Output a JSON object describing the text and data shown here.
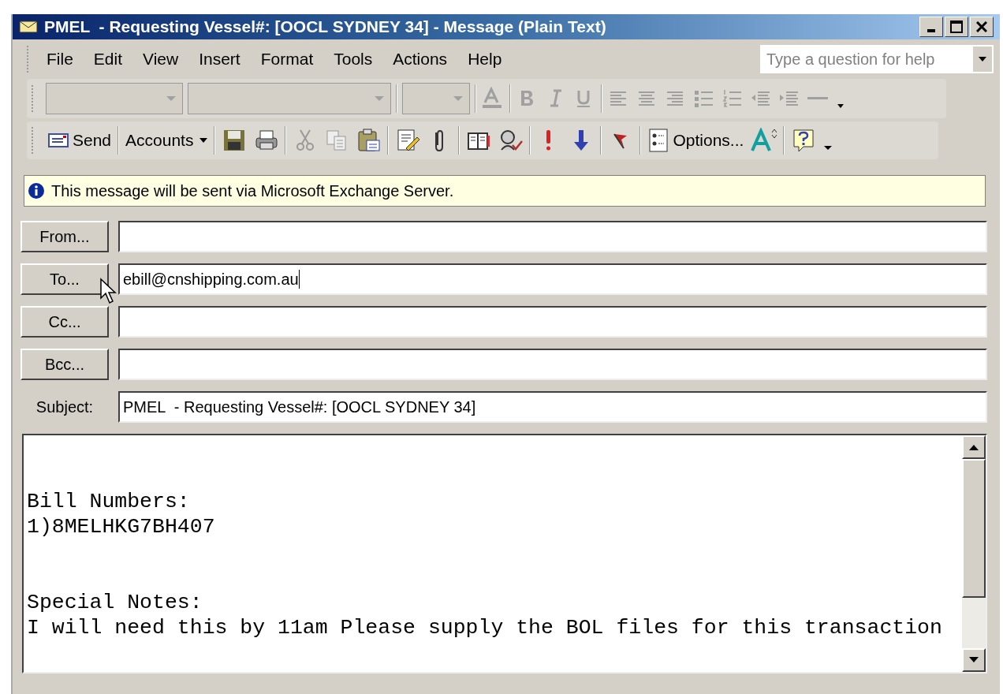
{
  "window": {
    "title": "PMEL  - Requesting Vessel#: [OOCL SYDNEY 34] - Message (Plain Text)"
  },
  "menu": [
    "File",
    "Edit",
    "View",
    "Insert",
    "Format",
    "Tools",
    "Actions",
    "Help"
  ],
  "help_box": {
    "placeholder": "Type a question for help"
  },
  "formatting_toolbar": {
    "disabled": true
  },
  "standard_toolbar": {
    "send": "Send",
    "accounts": "Accounts",
    "options": "Options..."
  },
  "info_bar": "This message will be sent via Microsoft Exchange Server.",
  "address_fields": [
    {
      "button": "From..."
    },
    {
      "button": "To...",
      "value": "ebill@cnshipping.com.au",
      "focused": true
    },
    {
      "button": "Cc..."
    },
    {
      "button": "Bcc..."
    }
  ],
  "subject": {
    "label": "Subject:",
    "value": "PMEL  - Requesting Vessel#: [OOCL SYDNEY 34]"
  },
  "body": [
    "Bill Numbers:",
    "1)8MELHKG7BH407",
    "Special Notes:",
    "I will need this by 11am Please supply the BOL files for this transaction"
  ]
}
